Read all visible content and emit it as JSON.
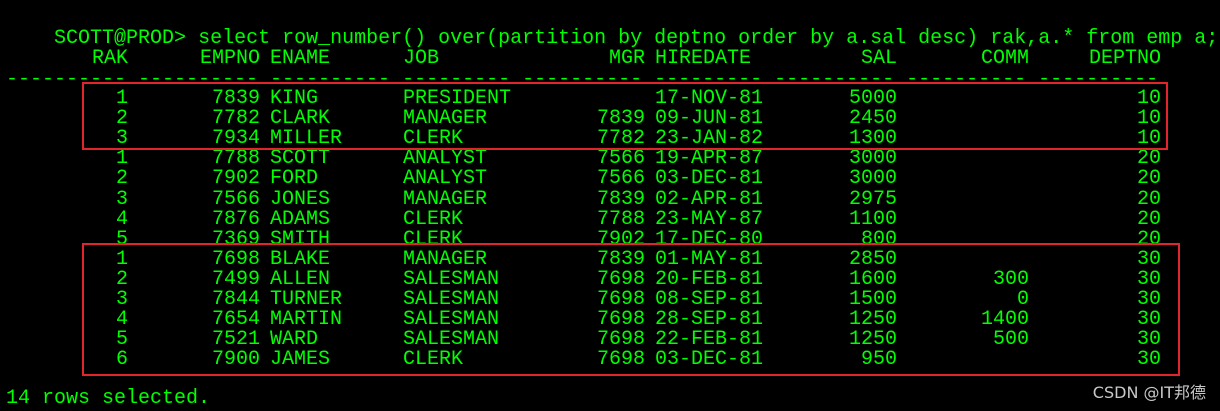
{
  "terminal": {
    "prompt": "SCOTT@PROD>",
    "command": "select row_number() over(partition by deptno order by a.sal desc) rak,a.* from emp a;",
    "columns": [
      "RAK",
      "EMPNO",
      "ENAME",
      "JOB",
      "MGR",
      "HIREDATE",
      "SAL",
      "COMM",
      "DEPTNO"
    ],
    "separator": "---------- ---------- ---------- --------- ---------- --------- ---------- ---------- ----------",
    "rows": [
      [
        "1",
        "7839",
        "KING",
        "PRESIDENT",
        "",
        "17-NOV-81",
        "5000",
        "",
        "10"
      ],
      [
        "2",
        "7782",
        "CLARK",
        "MANAGER",
        "7839",
        "09-JUN-81",
        "2450",
        "",
        "10"
      ],
      [
        "3",
        "7934",
        "MILLER",
        "CLERK",
        "7782",
        "23-JAN-82",
        "1300",
        "",
        "10"
      ],
      [
        "1",
        "7788",
        "SCOTT",
        "ANALYST",
        "7566",
        "19-APR-87",
        "3000",
        "",
        "20"
      ],
      [
        "2",
        "7902",
        "FORD",
        "ANALYST",
        "7566",
        "03-DEC-81",
        "3000",
        "",
        "20"
      ],
      [
        "3",
        "7566",
        "JONES",
        "MANAGER",
        "7839",
        "02-APR-81",
        "2975",
        "",
        "20"
      ],
      [
        "4",
        "7876",
        "ADAMS",
        "CLERK",
        "7788",
        "23-MAY-87",
        "1100",
        "",
        "20"
      ],
      [
        "5",
        "7369",
        "SMITH",
        "CLERK",
        "7902",
        "17-DEC-80",
        "800",
        "",
        "20"
      ],
      [
        "1",
        "7698",
        "BLAKE",
        "MANAGER",
        "7839",
        "01-MAY-81",
        "2850",
        "",
        "30"
      ],
      [
        "2",
        "7499",
        "ALLEN",
        "SALESMAN",
        "7698",
        "20-FEB-81",
        "1600",
        "300",
        "30"
      ],
      [
        "3",
        "7844",
        "TURNER",
        "SALESMAN",
        "7698",
        "08-SEP-81",
        "1500",
        "0",
        "30"
      ],
      [
        "4",
        "7654",
        "MARTIN",
        "SALESMAN",
        "7698",
        "28-SEP-81",
        "1250",
        "1400",
        "30"
      ],
      [
        "5",
        "7521",
        "WARD",
        "SALESMAN",
        "7698",
        "22-FEB-81",
        "1250",
        "500",
        "30"
      ],
      [
        "6",
        "7900",
        "JAMES",
        "CLERK",
        "7698",
        "03-DEC-81",
        "950",
        "",
        "30"
      ]
    ],
    "footer": "14 rows selected."
  },
  "watermark": "CSDN @IT邦德",
  "colors": {
    "background": "#000000",
    "text": "#00ff00",
    "highlight_box": "#e0252c",
    "watermark": "#c8c8c8"
  }
}
